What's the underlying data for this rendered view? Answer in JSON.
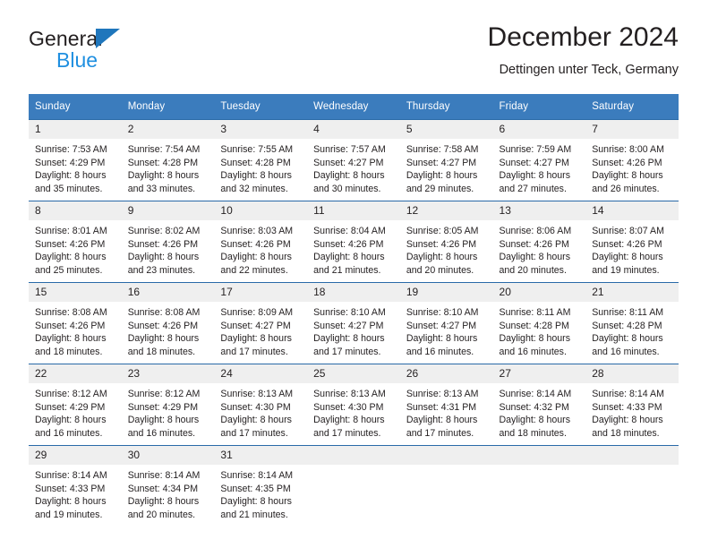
{
  "brand": {
    "name_top": "General",
    "name_bottom": "Blue",
    "triangle_color": "#1f76bc",
    "blue_text_color": "#1f8fe0"
  },
  "header": {
    "title": "December 2024",
    "subtitle": "Dettingen unter Teck, Germany"
  },
  "theme": {
    "header_bg": "#3b7cbd",
    "header_text": "#ffffff",
    "row_border": "#2a6aa8",
    "daynum_bg": "#efefef",
    "text": "#231f20"
  },
  "calendar": {
    "weekday_headers": [
      "Sunday",
      "Monday",
      "Tuesday",
      "Wednesday",
      "Thursday",
      "Friday",
      "Saturday"
    ],
    "weeks": [
      [
        {
          "day": "1",
          "sunrise": "Sunrise: 7:53 AM",
          "sunset": "Sunset: 4:29 PM",
          "daylight1": "Daylight: 8 hours",
          "daylight2": "and 35 minutes."
        },
        {
          "day": "2",
          "sunrise": "Sunrise: 7:54 AM",
          "sunset": "Sunset: 4:28 PM",
          "daylight1": "Daylight: 8 hours",
          "daylight2": "and 33 minutes."
        },
        {
          "day": "3",
          "sunrise": "Sunrise: 7:55 AM",
          "sunset": "Sunset: 4:28 PM",
          "daylight1": "Daylight: 8 hours",
          "daylight2": "and 32 minutes."
        },
        {
          "day": "4",
          "sunrise": "Sunrise: 7:57 AM",
          "sunset": "Sunset: 4:27 PM",
          "daylight1": "Daylight: 8 hours",
          "daylight2": "and 30 minutes."
        },
        {
          "day": "5",
          "sunrise": "Sunrise: 7:58 AM",
          "sunset": "Sunset: 4:27 PM",
          "daylight1": "Daylight: 8 hours",
          "daylight2": "and 29 minutes."
        },
        {
          "day": "6",
          "sunrise": "Sunrise: 7:59 AM",
          "sunset": "Sunset: 4:27 PM",
          "daylight1": "Daylight: 8 hours",
          "daylight2": "and 27 minutes."
        },
        {
          "day": "7",
          "sunrise": "Sunrise: 8:00 AM",
          "sunset": "Sunset: 4:26 PM",
          "daylight1": "Daylight: 8 hours",
          "daylight2": "and 26 minutes."
        }
      ],
      [
        {
          "day": "8",
          "sunrise": "Sunrise: 8:01 AM",
          "sunset": "Sunset: 4:26 PM",
          "daylight1": "Daylight: 8 hours",
          "daylight2": "and 25 minutes."
        },
        {
          "day": "9",
          "sunrise": "Sunrise: 8:02 AM",
          "sunset": "Sunset: 4:26 PM",
          "daylight1": "Daylight: 8 hours",
          "daylight2": "and 23 minutes."
        },
        {
          "day": "10",
          "sunrise": "Sunrise: 8:03 AM",
          "sunset": "Sunset: 4:26 PM",
          "daylight1": "Daylight: 8 hours",
          "daylight2": "and 22 minutes."
        },
        {
          "day": "11",
          "sunrise": "Sunrise: 8:04 AM",
          "sunset": "Sunset: 4:26 PM",
          "daylight1": "Daylight: 8 hours",
          "daylight2": "and 21 minutes."
        },
        {
          "day": "12",
          "sunrise": "Sunrise: 8:05 AM",
          "sunset": "Sunset: 4:26 PM",
          "daylight1": "Daylight: 8 hours",
          "daylight2": "and 20 minutes."
        },
        {
          "day": "13",
          "sunrise": "Sunrise: 8:06 AM",
          "sunset": "Sunset: 4:26 PM",
          "daylight1": "Daylight: 8 hours",
          "daylight2": "and 20 minutes."
        },
        {
          "day": "14",
          "sunrise": "Sunrise: 8:07 AM",
          "sunset": "Sunset: 4:26 PM",
          "daylight1": "Daylight: 8 hours",
          "daylight2": "and 19 minutes."
        }
      ],
      [
        {
          "day": "15",
          "sunrise": "Sunrise: 8:08 AM",
          "sunset": "Sunset: 4:26 PM",
          "daylight1": "Daylight: 8 hours",
          "daylight2": "and 18 minutes."
        },
        {
          "day": "16",
          "sunrise": "Sunrise: 8:08 AM",
          "sunset": "Sunset: 4:26 PM",
          "daylight1": "Daylight: 8 hours",
          "daylight2": "and 18 minutes."
        },
        {
          "day": "17",
          "sunrise": "Sunrise: 8:09 AM",
          "sunset": "Sunset: 4:27 PM",
          "daylight1": "Daylight: 8 hours",
          "daylight2": "and 17 minutes."
        },
        {
          "day": "18",
          "sunrise": "Sunrise: 8:10 AM",
          "sunset": "Sunset: 4:27 PM",
          "daylight1": "Daylight: 8 hours",
          "daylight2": "and 17 minutes."
        },
        {
          "day": "19",
          "sunrise": "Sunrise: 8:10 AM",
          "sunset": "Sunset: 4:27 PM",
          "daylight1": "Daylight: 8 hours",
          "daylight2": "and 16 minutes."
        },
        {
          "day": "20",
          "sunrise": "Sunrise: 8:11 AM",
          "sunset": "Sunset: 4:28 PM",
          "daylight1": "Daylight: 8 hours",
          "daylight2": "and 16 minutes."
        },
        {
          "day": "21",
          "sunrise": "Sunrise: 8:11 AM",
          "sunset": "Sunset: 4:28 PM",
          "daylight1": "Daylight: 8 hours",
          "daylight2": "and 16 minutes."
        }
      ],
      [
        {
          "day": "22",
          "sunrise": "Sunrise: 8:12 AM",
          "sunset": "Sunset: 4:29 PM",
          "daylight1": "Daylight: 8 hours",
          "daylight2": "and 16 minutes."
        },
        {
          "day": "23",
          "sunrise": "Sunrise: 8:12 AM",
          "sunset": "Sunset: 4:29 PM",
          "daylight1": "Daylight: 8 hours",
          "daylight2": "and 16 minutes."
        },
        {
          "day": "24",
          "sunrise": "Sunrise: 8:13 AM",
          "sunset": "Sunset: 4:30 PM",
          "daylight1": "Daylight: 8 hours",
          "daylight2": "and 17 minutes."
        },
        {
          "day": "25",
          "sunrise": "Sunrise: 8:13 AM",
          "sunset": "Sunset: 4:30 PM",
          "daylight1": "Daylight: 8 hours",
          "daylight2": "and 17 minutes."
        },
        {
          "day": "26",
          "sunrise": "Sunrise: 8:13 AM",
          "sunset": "Sunset: 4:31 PM",
          "daylight1": "Daylight: 8 hours",
          "daylight2": "and 17 minutes."
        },
        {
          "day": "27",
          "sunrise": "Sunrise: 8:14 AM",
          "sunset": "Sunset: 4:32 PM",
          "daylight1": "Daylight: 8 hours",
          "daylight2": "and 18 minutes."
        },
        {
          "day": "28",
          "sunrise": "Sunrise: 8:14 AM",
          "sunset": "Sunset: 4:33 PM",
          "daylight1": "Daylight: 8 hours",
          "daylight2": "and 18 minutes."
        }
      ],
      [
        {
          "day": "29",
          "sunrise": "Sunrise: 8:14 AM",
          "sunset": "Sunset: 4:33 PM",
          "daylight1": "Daylight: 8 hours",
          "daylight2": "and 19 minutes."
        },
        {
          "day": "30",
          "sunrise": "Sunrise: 8:14 AM",
          "sunset": "Sunset: 4:34 PM",
          "daylight1": "Daylight: 8 hours",
          "daylight2": "and 20 minutes."
        },
        {
          "day": "31",
          "sunrise": "Sunrise: 8:14 AM",
          "sunset": "Sunset: 4:35 PM",
          "daylight1": "Daylight: 8 hours",
          "daylight2": "and 21 minutes."
        },
        {
          "day": "",
          "sunrise": "",
          "sunset": "",
          "daylight1": "",
          "daylight2": ""
        },
        {
          "day": "",
          "sunrise": "",
          "sunset": "",
          "daylight1": "",
          "daylight2": ""
        },
        {
          "day": "",
          "sunrise": "",
          "sunset": "",
          "daylight1": "",
          "daylight2": ""
        },
        {
          "day": "",
          "sunrise": "",
          "sunset": "",
          "daylight1": "",
          "daylight2": ""
        }
      ]
    ]
  }
}
